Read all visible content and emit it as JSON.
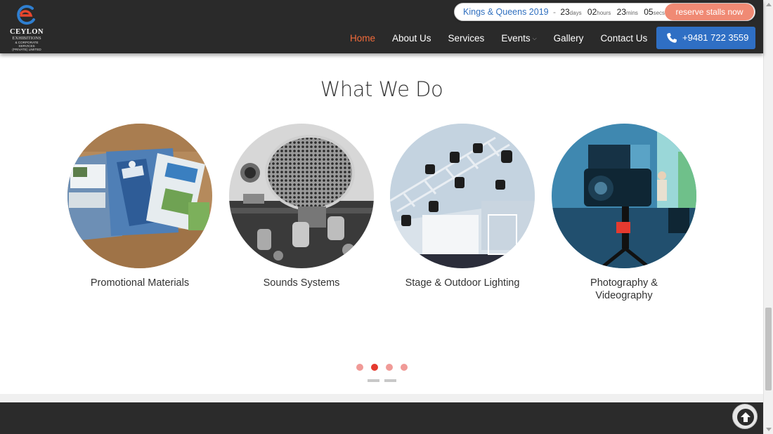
{
  "brand": {
    "name": "CEYLON",
    "line2": "EXHIBITIONS",
    "line3": "& CORPORATE SERVICES",
    "line4": "(PRIVATE) LIMITED"
  },
  "countdown": {
    "event": "Kings & Queens 2019",
    "separator": "-",
    "days": "23",
    "days_unit": "days",
    "hours": "02",
    "hours_unit": "hours",
    "mins": "23",
    "mins_unit": "mins",
    "secs": "05",
    "secs_unit": "secs",
    "trailing_separator": "-",
    "button_label": "reserve stalls now"
  },
  "nav": {
    "items": [
      {
        "label": "Home",
        "active": true
      },
      {
        "label": "About Us"
      },
      {
        "label": "Services"
      },
      {
        "label": "Events"
      },
      {
        "label": "Gallery"
      },
      {
        "label": "Contact Us"
      }
    ],
    "phone": "+9481 722 3559"
  },
  "section": {
    "title": "What We Do",
    "services": [
      {
        "caption": "Promotional Materials",
        "icon": "promotional-materials-image"
      },
      {
        "caption": "Sounds Systems",
        "icon": "microphone-image"
      },
      {
        "caption": "Stage & Outdoor Lighting",
        "icon": "stage-lighting-image"
      },
      {
        "caption": "Photography & Videography",
        "icon": "video-camera-image"
      }
    ]
  },
  "carousel": {
    "dot_count": 4,
    "active_dot": 2,
    "dash_count": 2
  },
  "colors": {
    "header_bg": "#2a2a2a",
    "accent_orange": "#f26b3a",
    "button_salmon": "#f08a74",
    "phone_blue": "#2f6fc4",
    "dot_active": "#e53a2f",
    "dot_inactive": "#f09a97"
  }
}
